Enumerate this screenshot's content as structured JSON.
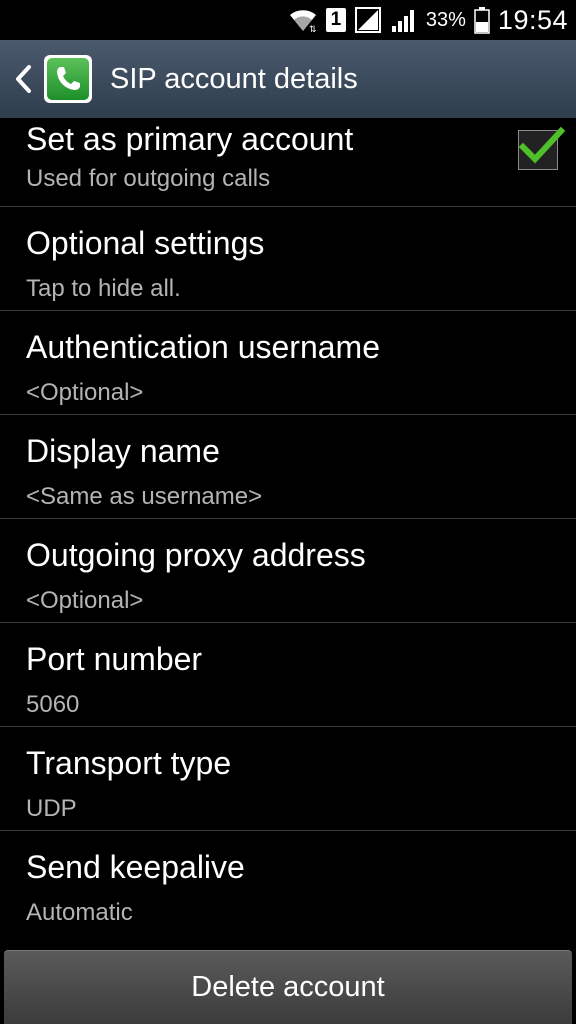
{
  "status_bar": {
    "battery_percent": "33%",
    "time": "19:54",
    "sim_label": "1",
    "icons": [
      "wifi-icon",
      "sim-icon",
      "no-signal-icon",
      "signal-icon",
      "battery-icon"
    ]
  },
  "action_bar": {
    "title": "SIP account details",
    "app_icon": "phone-icon"
  },
  "settings": [
    {
      "title": "Set as primary account",
      "subtitle": "Used for outgoing calls",
      "checked": true
    },
    {
      "title": "Optional settings",
      "subtitle": "Tap to hide all."
    },
    {
      "title": "Authentication username",
      "subtitle": "<Optional>"
    },
    {
      "title": "Display name",
      "subtitle": "<Same as username>"
    },
    {
      "title": "Outgoing proxy address",
      "subtitle": "<Optional>"
    },
    {
      "title": "Port number",
      "subtitle": "5060"
    },
    {
      "title": "Transport type",
      "subtitle": "UDP"
    },
    {
      "title": "Send keepalive",
      "subtitle": "Automatic"
    }
  ],
  "delete_button": {
    "label": "Delete account"
  },
  "colors": {
    "action_bar": "#3b4b5e",
    "check_green": "#4fc02a",
    "subtitle_gray": "#b4b4b4"
  }
}
